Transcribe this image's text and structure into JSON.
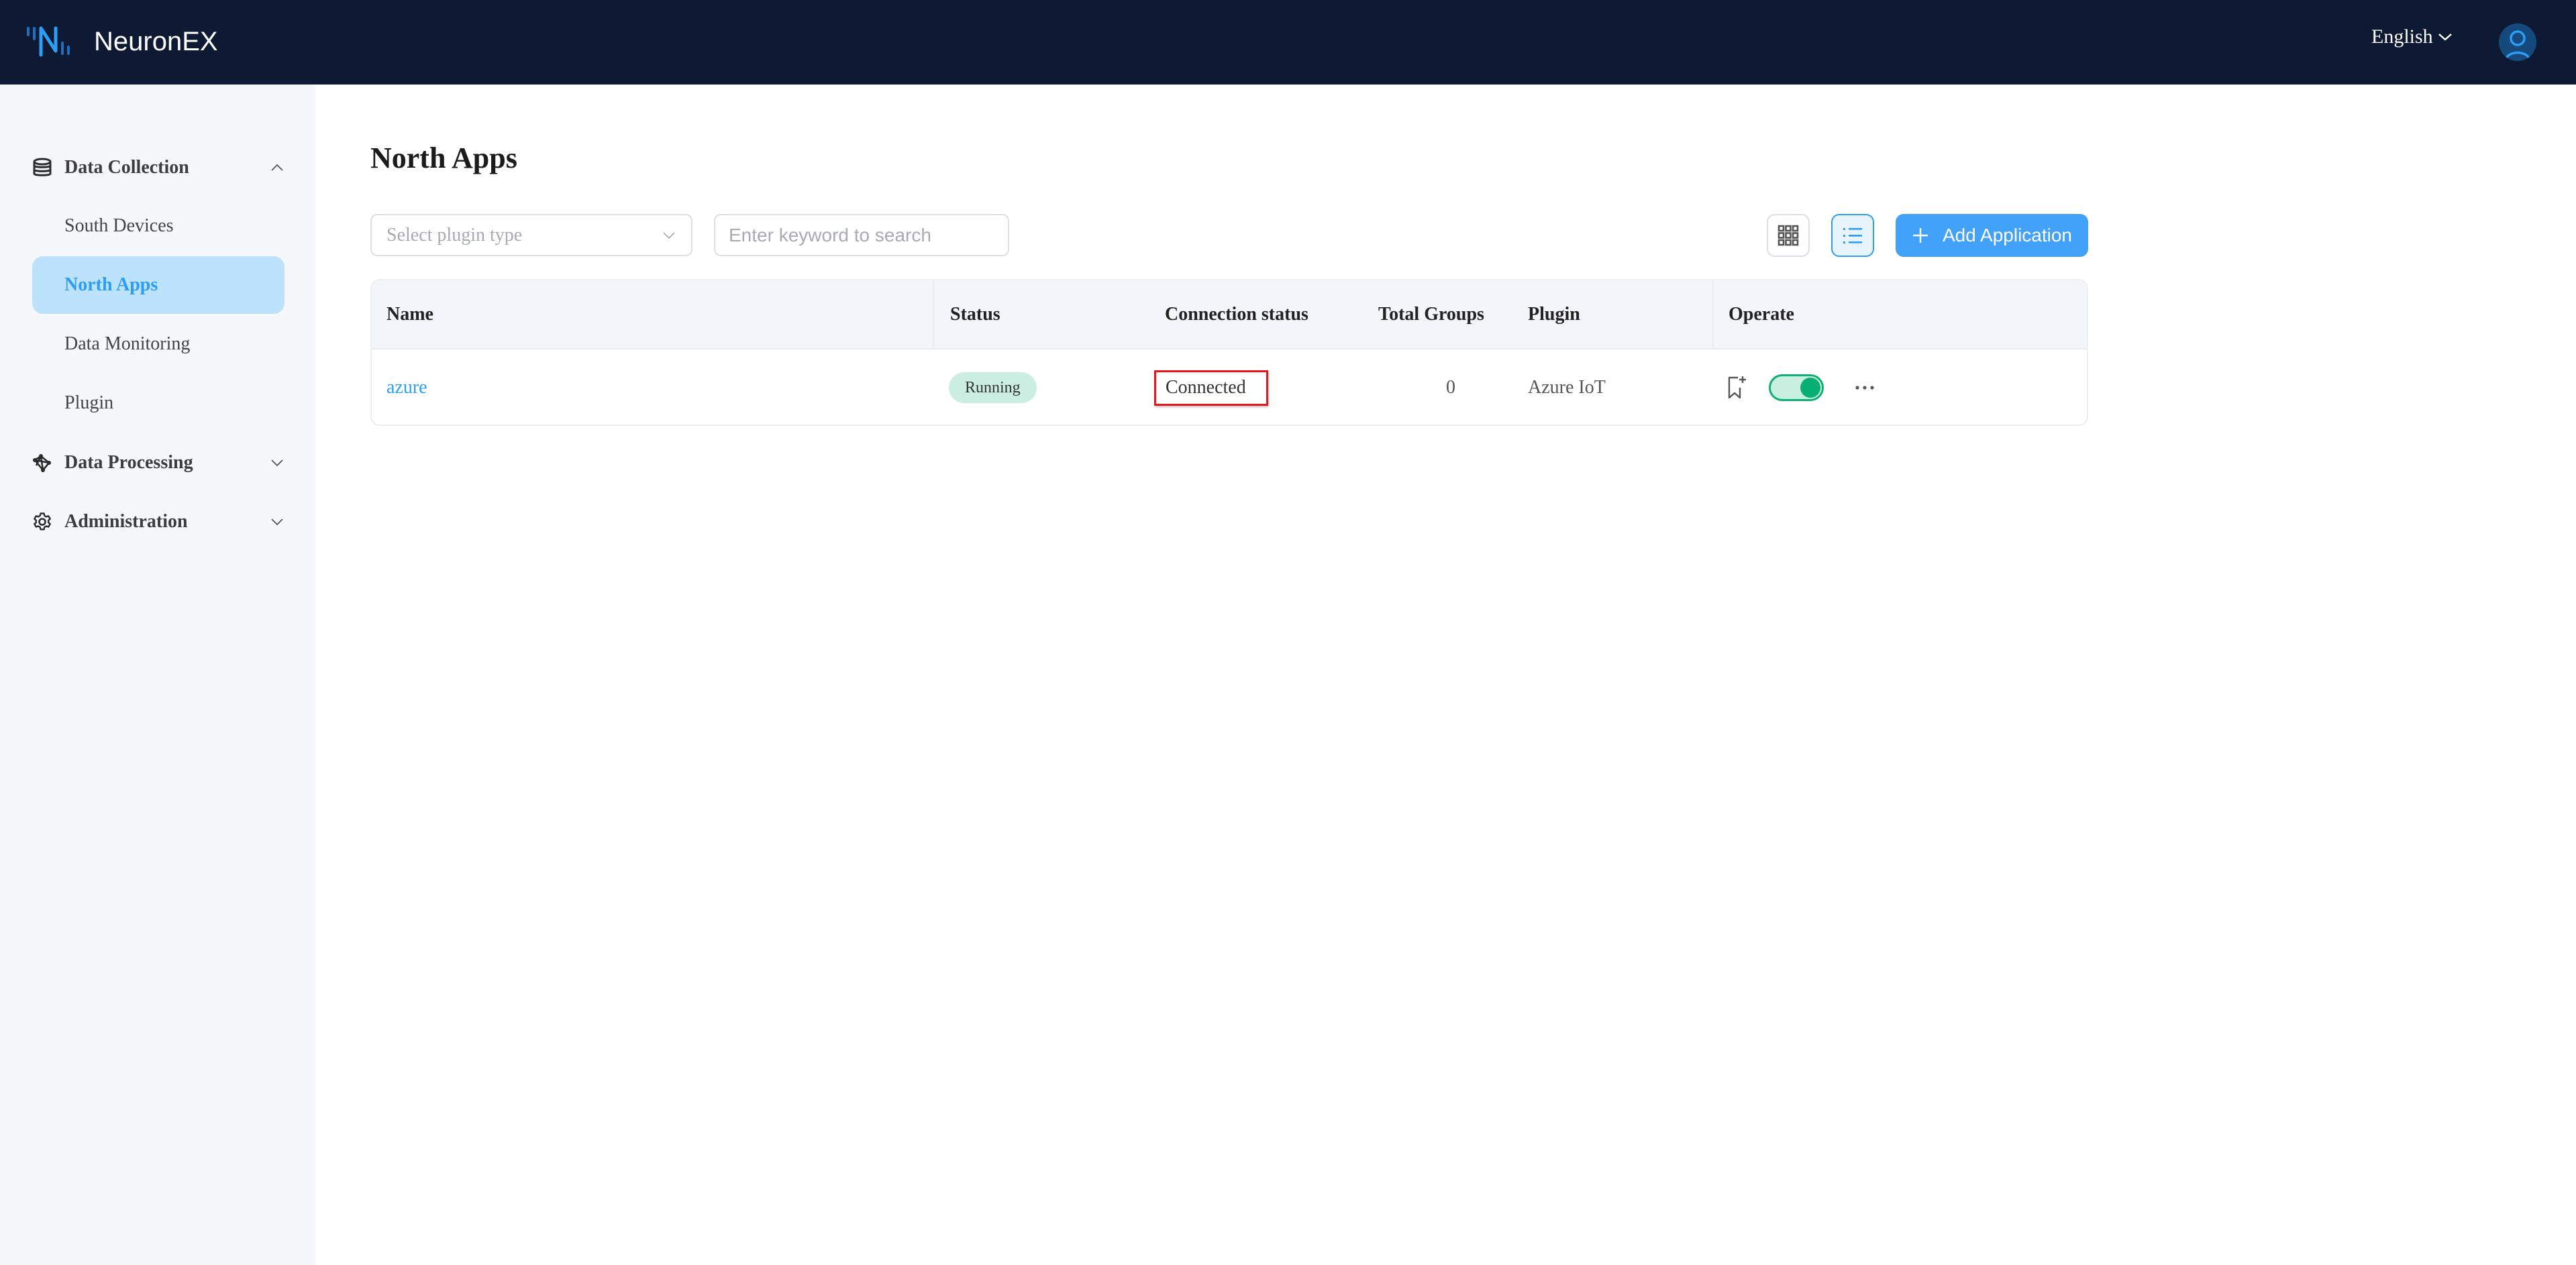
{
  "app": {
    "title": "NeuronEX"
  },
  "header": {
    "language": "English",
    "icons": {
      "logo": "neuronex-logo-icon",
      "language_chevron": "chevron-down-icon",
      "avatar": "user-avatar-icon"
    }
  },
  "sidebar": {
    "groups": [
      {
        "label": "Data Collection",
        "icon": "database-icon",
        "expanded": true,
        "items": [
          {
            "label": "South Devices",
            "active": false
          },
          {
            "label": "North Apps",
            "active": true
          },
          {
            "label": "Data Monitoring",
            "active": false
          },
          {
            "label": "Plugin",
            "active": false
          }
        ]
      },
      {
        "label": "Data Processing",
        "icon": "network-icon",
        "expanded": false
      },
      {
        "label": "Administration",
        "icon": "gear-icon",
        "expanded": false
      }
    ]
  },
  "main": {
    "title": "North Apps",
    "filters": {
      "plugin_type_placeholder": "Select plugin type",
      "search_placeholder": "Enter keyword to search",
      "search_value": ""
    },
    "view_modes": {
      "current": "list",
      "options": [
        "grid",
        "list"
      ]
    },
    "add_button_label": "Add Application",
    "table": {
      "columns": [
        "Name",
        "Status",
        "Connection status",
        "Total Groups",
        "Plugin",
        "Operate"
      ],
      "rows": [
        {
          "name": "azure",
          "status": "Running",
          "connection_status": "Connected",
          "total_groups": "0",
          "plugin": "Azure IoT",
          "enabled": true
        }
      ]
    }
  },
  "colors": {
    "header_bg": "#0e1a33",
    "sidebar_bg": "#f5f7fb",
    "accent": "#2d9ef5",
    "active_nav_bg": "#bde2fb",
    "primary_button": "#42a1f8",
    "running_badge_bg": "#cbeee2",
    "toggle_on": "#07b072",
    "highlight_box": "#e8161b"
  }
}
